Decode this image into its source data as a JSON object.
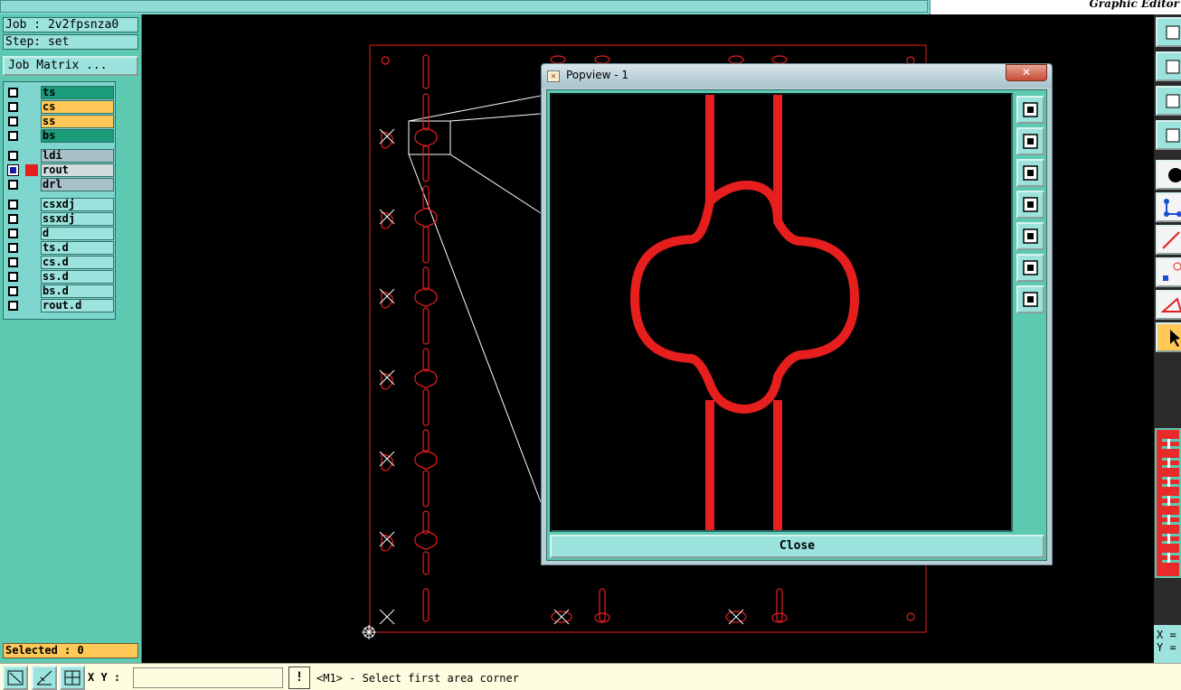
{
  "app": {
    "title": "Graphic Editor"
  },
  "job": {
    "job_line": "Job : 2v2fpsnza0",
    "step_line": "Step: set",
    "matrix_button": "Job Matrix ..."
  },
  "layers": [
    {
      "label": "ts",
      "color": "green"
    },
    {
      "label": "cs",
      "color": "orange"
    },
    {
      "label": "ss",
      "color": "orange"
    },
    {
      "label": "bs",
      "color": "green"
    },
    {
      "label": "ldi",
      "color": "gray"
    },
    {
      "label": "rout",
      "color": "whiteish",
      "active": true
    },
    {
      "label": "drl",
      "color": "gray"
    },
    {
      "label": "csxdj",
      "color": "light"
    },
    {
      "label": "ssxdj",
      "color": "light"
    },
    {
      "label": "d",
      "color": "light"
    },
    {
      "label": "ts.d",
      "color": "light"
    },
    {
      "label": "cs.d",
      "color": "light"
    },
    {
      "label": "ss.d",
      "color": "light"
    },
    {
      "label": "bs.d",
      "color": "light"
    },
    {
      "label": "rout.d",
      "color": "light"
    }
  ],
  "selected": "Selected : 0",
  "popview": {
    "title": "Popview - 1",
    "close_x": "✕",
    "close_label": "Close"
  },
  "coords": {
    "x_label": "X =",
    "y_label": "Y ="
  },
  "bottom": {
    "xy_label": "X Y :",
    "xy_value": "",
    "warn_label": "!",
    "status": "<M1> - Select first area corner"
  },
  "colors": {
    "rout": "#e61e1e",
    "panel": "#5cc9b0",
    "accent": "#ffc857"
  }
}
